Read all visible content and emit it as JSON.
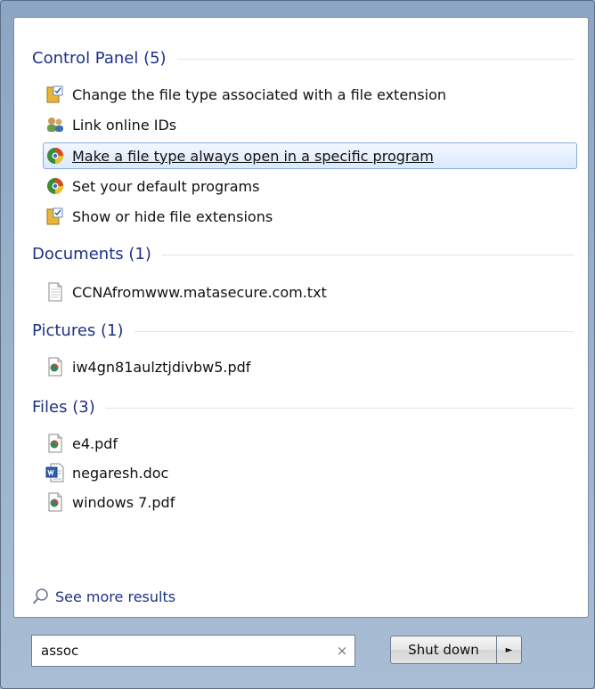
{
  "groups": [
    {
      "title": "Control Panel (5)",
      "items": [
        {
          "label": "Change the file type associated with a file extension",
          "icon": "folder-options-icon"
        },
        {
          "label": "Link online IDs",
          "icon": "users-icon"
        },
        {
          "label": "Make a file type always open in a specific program",
          "icon": "default-programs-icon",
          "selected": true
        },
        {
          "label": "Set your default programs",
          "icon": "default-programs-icon"
        },
        {
          "label": "Show or hide file extensions",
          "icon": "folder-options-icon"
        }
      ]
    },
    {
      "title": "Documents (1)",
      "items": [
        {
          "label": "CCNAfromwww.matasecure.com.txt",
          "icon": "text-file-icon"
        }
      ]
    },
    {
      "title": "Pictures (1)",
      "items": [
        {
          "label": "iw4gn81aulztjdivbw5.pdf",
          "icon": "pdf-file-icon"
        }
      ]
    },
    {
      "title": "Files (3)",
      "items": [
        {
          "label": "e4.pdf",
          "icon": "pdf-file-icon"
        },
        {
          "label": "negaresh.doc",
          "icon": "word-file-icon"
        },
        {
          "label": "windows 7.pdf",
          "icon": "pdf-file-icon"
        }
      ]
    }
  ],
  "see_more": {
    "label": "See more results",
    "icon": "search-icon"
  },
  "search": {
    "value": "assoc",
    "clear_symbol": "×"
  },
  "shutdown": {
    "label": "Shut down",
    "arrow": "►"
  }
}
